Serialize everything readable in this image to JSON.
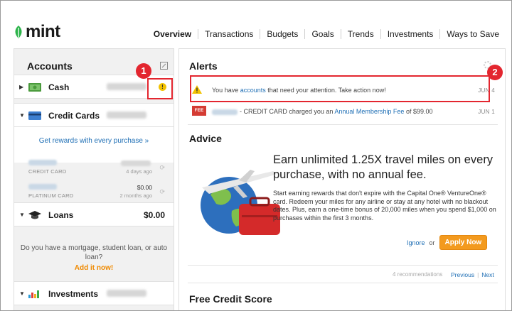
{
  "brand": {
    "name": "mint",
    "color": "#2cb44a"
  },
  "nav": [
    {
      "label": "Overview",
      "active": true
    },
    {
      "label": "Transactions",
      "active": false
    },
    {
      "label": "Budgets",
      "active": false
    },
    {
      "label": "Goals",
      "active": false
    },
    {
      "label": "Trends",
      "active": false
    },
    {
      "label": "Investments",
      "active": false
    },
    {
      "label": "Ways to Save",
      "active": false
    }
  ],
  "sidebar": {
    "title": "Accounts",
    "accounts": {
      "cash": {
        "label": "Cash",
        "alert": "!"
      },
      "credit_cards": {
        "label": "Credit Cards"
      },
      "loans": {
        "label": "Loans",
        "amount": "$0.00"
      },
      "investments": {
        "label": "Investments"
      }
    },
    "promo_link": "Get rewards with every purchase »",
    "cards": [
      {
        "type": "CREDIT CARD",
        "amount": "",
        "when": "4 days ago"
      },
      {
        "type": "PLATINUM CARD",
        "amount": "$0.00",
        "when": "2 months ago"
      }
    ],
    "loans_note": "Do you have a mortgage, student loan, or auto loan?",
    "loans_add": "Add it now!"
  },
  "alerts": {
    "title": "Alerts",
    "items": [
      {
        "pre": "You have ",
        "link": "accounts",
        "post": " that need your attention. Take action now!",
        "date": "JUN 4"
      },
      {
        "badge": "FEE",
        "text": "- CREDIT CARD charged you an ",
        "link": "Annual Membership Fee",
        "post": " of $99.00",
        "date": "JUN 1"
      }
    ]
  },
  "advice": {
    "title": "Advice",
    "headline": "Earn unlimited 1.25X travel miles on every purchase, with no annual fee.",
    "body": "Start earning rewards that don't expire with the Capital One® VentureOne® card. Redeem your miles for any airline or stay at any hotel with no blackout dates. Plus, earn a one-time bonus of 20,000 miles when you spend $1,000 on purchases within the first 3 months.",
    "ignore": "Ignore",
    "or": "or",
    "apply": "Apply Now",
    "recommendations": "4 recommendations",
    "previous": "Previous",
    "separator": "|",
    "next": "Next"
  },
  "credit_score": {
    "title": "Free Credit Score"
  },
  "callouts": [
    "1",
    "2"
  ],
  "colors": {
    "accent_link": "#1f6fb5",
    "callout_red": "#e3262f",
    "apply_orange": "#f39a1e",
    "alert_yellow": "#f2c200",
    "fee_red": "#d43c34"
  }
}
